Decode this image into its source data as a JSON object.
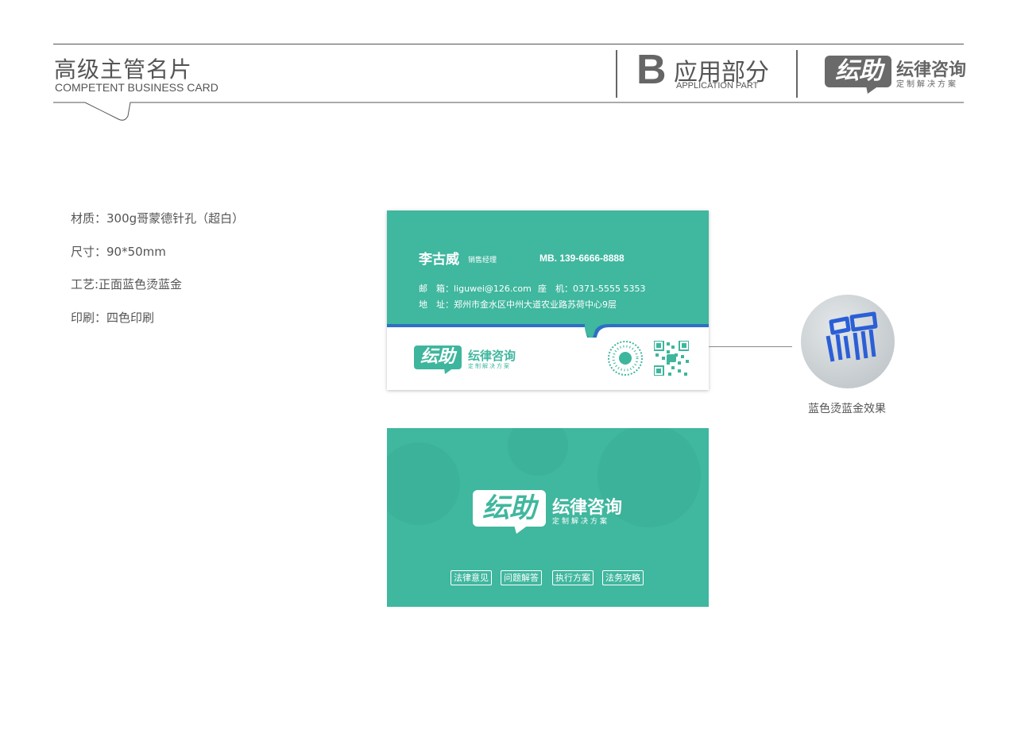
{
  "header": {
    "title": "高级主管名片",
    "subtitle": "COMPETENT BUSINESS CARD",
    "section_letter": "B",
    "section_title": "应用部分",
    "section_subtitle": "APPLICATION PART"
  },
  "brand": {
    "mark": "纭助",
    "name": "纭律咨询",
    "tagline": "定制解决方案"
  },
  "specs": [
    "材质：300g哥蒙德针孔（超白）",
    "尺寸：90*50mm",
    "工艺:正面蓝色烫蓝金",
    "印刷：四色印刷"
  ],
  "card_front": {
    "name": "李古威",
    "title": "销售经理",
    "mobile": "MB. 139-6666-8888",
    "email": "邮　箱：liguwei@126.com",
    "phone": "座　机：0371-5555 5353",
    "address": "地　址：郑州市金水区中州大道农业路苏荷中心9层"
  },
  "stamp_caption": "蓝色烫蓝金效果",
  "card_back": {
    "tags": [
      "法律意见",
      "问题解答",
      "执行方案",
      "法务攻略"
    ]
  },
  "colors": {
    "teal": "#40b79f",
    "blue": "#2e6fc4",
    "gray": "#666666"
  }
}
